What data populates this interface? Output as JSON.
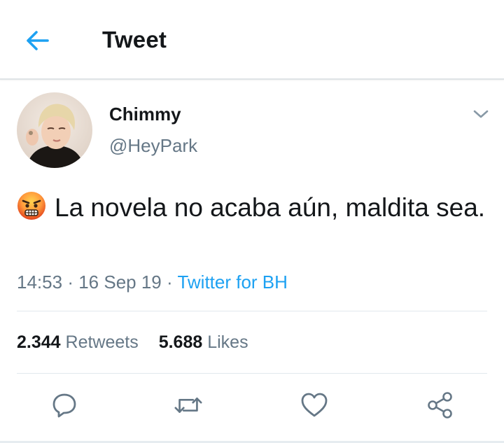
{
  "header": {
    "title": "Tweet",
    "back_icon": "arrow-left-icon",
    "accent_color": "#1da1f2"
  },
  "tweet": {
    "display_name": "Chimmy",
    "handle": "@HeyPark",
    "emoji_icon": "angry-face-emoji",
    "text": "La novela no acaba aún, maldita sea.",
    "time": "14:53",
    "date": "16 Sep 19",
    "source": "Twitter for BH",
    "separator": "·"
  },
  "stats": {
    "retweets_count": "2.344",
    "retweets_label": "Retweets",
    "likes_count": "5.688",
    "likes_label": "Likes"
  },
  "actions": [
    "reply-icon",
    "retweet-icon",
    "like-icon",
    "share-icon"
  ]
}
